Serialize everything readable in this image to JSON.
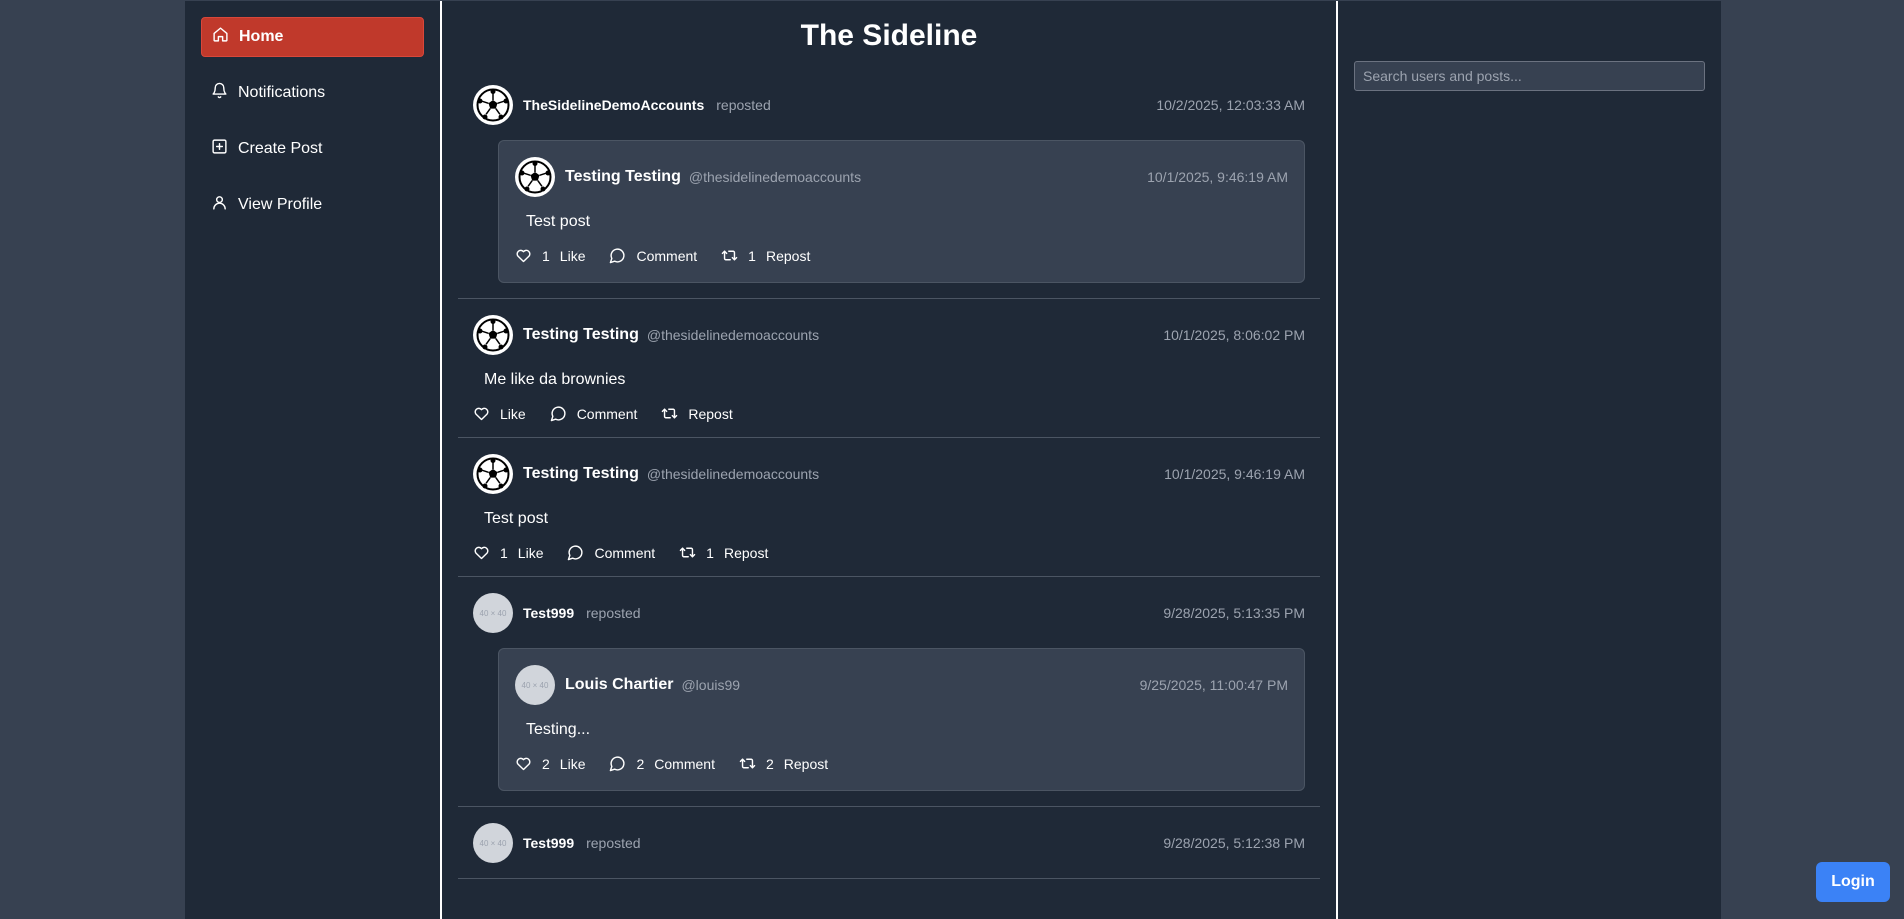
{
  "app": {
    "title": "The Sideline"
  },
  "sidebar": {
    "items": [
      {
        "label": "Home",
        "icon": "home-icon",
        "active": true
      },
      {
        "label": "Notifications",
        "icon": "bell-icon"
      },
      {
        "label": "Create Post",
        "icon": "plus-square-icon"
      },
      {
        "label": "View Profile",
        "icon": "user-icon"
      }
    ]
  },
  "search": {
    "placeholder": "Search users and posts..."
  },
  "login": {
    "label": "Login"
  },
  "labels": {
    "like": "Like",
    "comment": "Comment",
    "repost": "Repost",
    "reposted": "reposted"
  },
  "colors": {
    "accent": "#c0392b",
    "primary": "#3b82f6",
    "background": "#1f2937",
    "card": "#374151"
  },
  "posts": [
    {
      "reposter": "TheSidelineDemoAccounts",
      "time": "10/2/2025, 12:03:33 AM",
      "quote": {
        "name": "Testing Testing",
        "handle": "@thesidelinedemoaccounts",
        "time": "10/1/2025, 9:46:19 AM",
        "text": "Test post",
        "likes": "1",
        "comments": "",
        "reposts": "1"
      }
    },
    {
      "name": "Testing Testing",
      "handle": "@thesidelinedemoaccounts",
      "time": "10/1/2025, 8:06:02 PM",
      "text": "Me like da brownies",
      "likes": "",
      "comments": "",
      "reposts": ""
    },
    {
      "name": "Testing Testing",
      "handle": "@thesidelinedemoaccounts",
      "time": "10/1/2025, 9:46:19 AM",
      "text": "Test post",
      "likes": "1",
      "comments": "",
      "reposts": "1"
    },
    {
      "reposter": "Test999",
      "time": "9/28/2025, 5:13:35 PM",
      "quote": {
        "name": "Louis Chartier",
        "handle": "@louis99",
        "time": "9/25/2025, 11:00:47 PM",
        "text": "Testing...",
        "likes": "2",
        "comments": "2",
        "reposts": "2"
      }
    },
    {
      "reposter": "Test999",
      "time": "9/28/2025, 5:12:38 PM"
    }
  ],
  "placeholder_avatar": "40 × 40"
}
